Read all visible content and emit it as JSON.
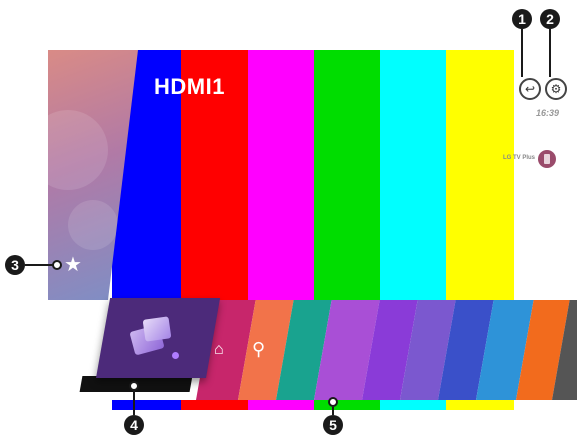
{
  "screen": {
    "input_label": "HDMI1",
    "clock": "16:39",
    "cast_label": "LG TV Plus",
    "color_bars": [
      "#0000ff",
      "#ff0000",
      "#ff00ff",
      "#00dd00",
      "#00ffff",
      "#ffff00"
    ]
  },
  "icons": {
    "favorite": "star-icon",
    "input": "input-icon",
    "settings": "gear-icon",
    "store": "lg-content-store-icon",
    "search": "search-icon"
  },
  "launcher": {
    "tile_colors": [
      "#c7266b",
      "#f2734a",
      "#19a38f",
      "#a94fd6",
      "#8a3bd8",
      "#7b58cf",
      "#3a50c9",
      "#2e93d8",
      "#f26b1d",
      "#555555"
    ]
  },
  "callouts": [
    "1",
    "2",
    "3",
    "4",
    "5"
  ]
}
